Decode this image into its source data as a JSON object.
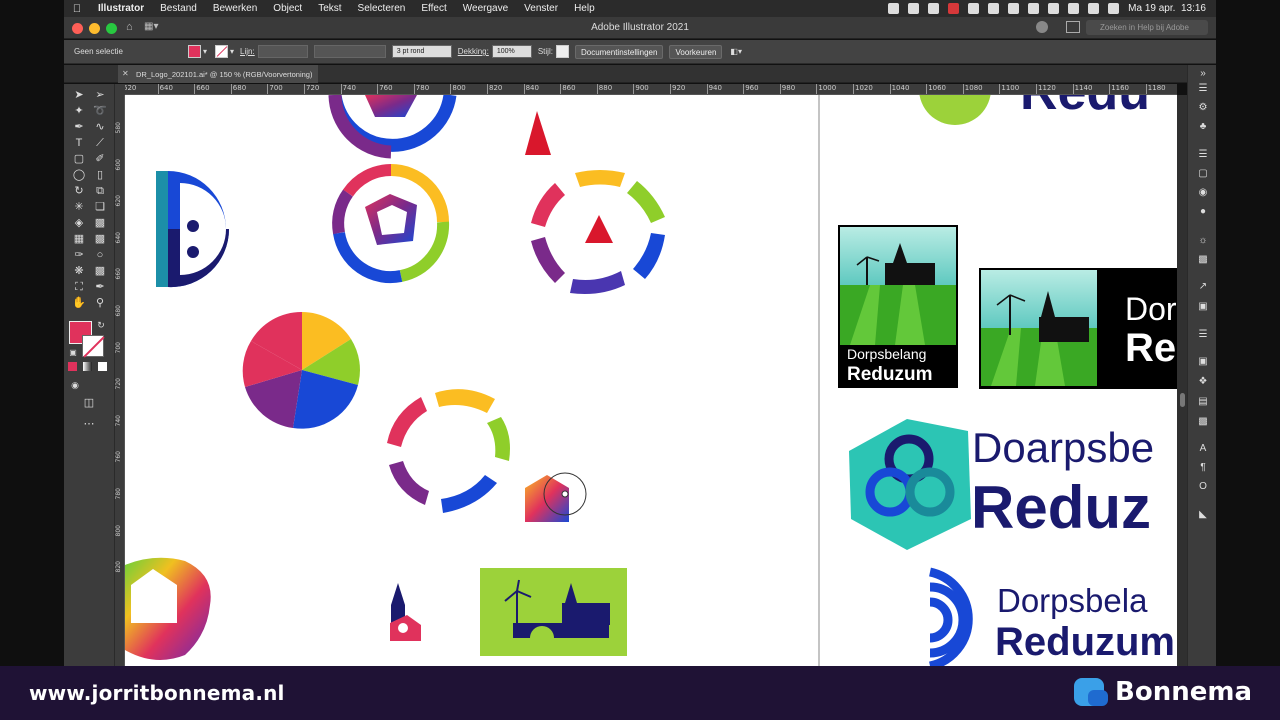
{
  "menubar": {
    "items": [
      "Illustrator",
      "Bestand",
      "Bewerken",
      "Object",
      "Tekst",
      "Selecteren",
      "Effect",
      "Weergave",
      "Venster",
      "Help"
    ],
    "datetime": "Ma 19 apr.  13:16"
  },
  "window": {
    "title": "Adobe Illustrator 2021",
    "help_search_placeholder": "Zoeken in Help bij Adobe"
  },
  "controlbar": {
    "selection": "Geen selectie",
    "fill_color": "#e0325c",
    "stroke_label": "Lijn:",
    "brush": "3 pt rond",
    "opacity_label": "Dekking:",
    "opacity_value": "100%",
    "style_label": "Stijl:",
    "doc_settings": "Documentinstellingen",
    "preferences": "Voorkeuren"
  },
  "document": {
    "tab_title": "DR_Logo_202101.ai* @ 150 % (RGB/Voorvertoning)"
  },
  "rulers": {
    "horizontal": [
      "620",
      "640",
      "660",
      "680",
      "700",
      "720",
      "740",
      "760",
      "780",
      "800",
      "820",
      "840",
      "860",
      "880",
      "900",
      "920",
      "940",
      "960",
      "980",
      "1000",
      "1020",
      "1040",
      "1060",
      "1080",
      "1100",
      "1120",
      "1140",
      "1160",
      "1180"
    ],
    "vertical": [
      "580",
      "600",
      "620",
      "640",
      "660",
      "680",
      "700",
      "720",
      "740",
      "760",
      "780",
      "800",
      "820"
    ]
  },
  "artwork": {
    "logo1_line1": "Dorpsbelang",
    "logo1_line2": "Reduzum",
    "logo2_line1": "Dor",
    "logo2_line2": "Re",
    "logo3_line1": "Doarpsbe",
    "logo3_line2": "Reduz",
    "logo4_line1": "Dorpsbela",
    "logo4_line2": "Reduzum",
    "top_partial": "Redu"
  },
  "footer": {
    "url": "www.jorritbonnema.nl",
    "brand": "Bonnema"
  }
}
